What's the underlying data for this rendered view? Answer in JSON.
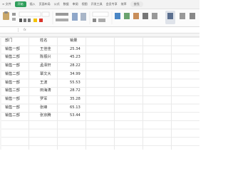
{
  "ribbon": {
    "tabs": [
      {
        "label": "≡ 文件"
      },
      {
        "label": "开始",
        "active": true
      },
      {
        "label": "插入"
      },
      {
        "label": "页面布局"
      },
      {
        "label": "公式"
      },
      {
        "label": "数据"
      },
      {
        "label": "审阅"
      },
      {
        "label": "视图"
      },
      {
        "label": "开发工具"
      },
      {
        "label": "会员专享"
      },
      {
        "label": "效率"
      },
      {
        "label": "查找",
        "search": true
      }
    ]
  },
  "formula_bar": {
    "fx": "fx"
  },
  "table": {
    "headers": {
      "dept": "部门",
      "name": "姓名",
      "sales": "销量"
    },
    "rows": [
      {
        "dept": "销售一部",
        "name": "王佳佳",
        "sales": "25.34"
      },
      {
        "dept": "销售二部",
        "name": "陈振兴",
        "sales": "45.23"
      },
      {
        "dept": "销售一部",
        "name": "孟泽轩",
        "sales": "28.22"
      },
      {
        "dept": "销售二部",
        "name": "覃文大",
        "sales": "34.99"
      },
      {
        "dept": "销售一部",
        "name": "王波",
        "sales": "55.53"
      },
      {
        "dept": "销售二部",
        "name": "田海涛",
        "sales": "28.72"
      },
      {
        "dept": "销售一部",
        "name": "罗军",
        "sales": "35.28"
      },
      {
        "dept": "销售一部",
        "name": "张峰",
        "sales": "65.13"
      },
      {
        "dept": "销售二部",
        "name": "张京腾",
        "sales": "53.44"
      }
    ]
  }
}
